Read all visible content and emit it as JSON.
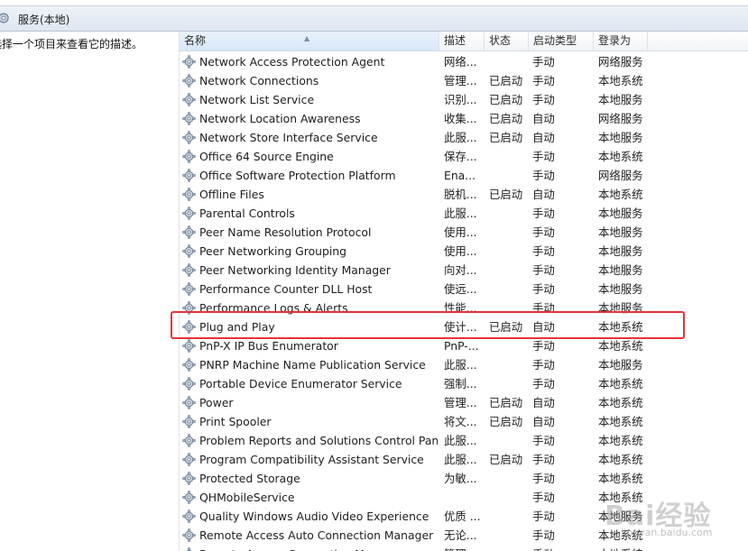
{
  "window": {
    "title": "服务(本地)"
  },
  "description_pane": {
    "text": "选择一个项目来查看它的描述。"
  },
  "columns": {
    "name": "名称",
    "desc": "描述",
    "status": "状态",
    "startup": "启动类型",
    "logon": "登录为"
  },
  "services": [
    {
      "name": "Network Access Protection Agent",
      "desc": "网络...",
      "status": "",
      "startup": "手动",
      "logon": "网络服务"
    },
    {
      "name": "Network Connections",
      "desc": "管理...",
      "status": "已启动",
      "startup": "手动",
      "logon": "本地系统"
    },
    {
      "name": "Network List Service",
      "desc": "识别...",
      "status": "已启动",
      "startup": "手动",
      "logon": "本地服务"
    },
    {
      "name": "Network Location Awareness",
      "desc": "收集...",
      "status": "已启动",
      "startup": "自动",
      "logon": "网络服务"
    },
    {
      "name": "Network Store Interface Service",
      "desc": "此服...",
      "status": "已启动",
      "startup": "自动",
      "logon": "本地服务"
    },
    {
      "name": "Office 64 Source Engine",
      "desc": "保存...",
      "status": "",
      "startup": "手动",
      "logon": "本地系统"
    },
    {
      "name": "Office Software Protection Platform",
      "desc": "Ena...",
      "status": "",
      "startup": "手动",
      "logon": "网络服务"
    },
    {
      "name": "Offline Files",
      "desc": "脱机...",
      "status": "已启动",
      "startup": "自动",
      "logon": "本地系统"
    },
    {
      "name": "Parental Controls",
      "desc": "此服...",
      "status": "",
      "startup": "手动",
      "logon": "本地服务"
    },
    {
      "name": "Peer Name Resolution Protocol",
      "desc": "使用...",
      "status": "",
      "startup": "手动",
      "logon": "本地服务"
    },
    {
      "name": "Peer Networking Grouping",
      "desc": "使用...",
      "status": "",
      "startup": "手动",
      "logon": "本地服务"
    },
    {
      "name": "Peer Networking Identity Manager",
      "desc": "向对...",
      "status": "",
      "startup": "手动",
      "logon": "本地服务"
    },
    {
      "name": "Performance Counter DLL Host",
      "desc": "使远...",
      "status": "",
      "startup": "手动",
      "logon": "本地服务"
    },
    {
      "name": "Performance Logs & Alerts",
      "desc": "性能...",
      "status": "",
      "startup": "手动",
      "logon": "本地服务"
    },
    {
      "name": "Plug and Play",
      "desc": "使计...",
      "status": "已启动",
      "startup": "自动",
      "logon": "本地系统"
    },
    {
      "name": "PnP-X IP Bus Enumerator",
      "desc": "PnP-...",
      "status": "",
      "startup": "手动",
      "logon": "本地系统"
    },
    {
      "name": "PNRP Machine Name Publication Service",
      "desc": "此服...",
      "status": "",
      "startup": "手动",
      "logon": "本地服务"
    },
    {
      "name": "Portable Device Enumerator Service",
      "desc": "强制...",
      "status": "",
      "startup": "手动",
      "logon": "本地系统"
    },
    {
      "name": "Power",
      "desc": "管理...",
      "status": "已启动",
      "startup": "自动",
      "logon": "本地系统"
    },
    {
      "name": "Print Spooler",
      "desc": "将文...",
      "status": "已启动",
      "startup": "自动",
      "logon": "本地系统"
    },
    {
      "name": "Problem Reports and Solutions Control Pan...",
      "desc": "此服...",
      "status": "",
      "startup": "手动",
      "logon": "本地系统"
    },
    {
      "name": "Program Compatibility Assistant Service",
      "desc": "此服...",
      "status": "已启动",
      "startup": "手动",
      "logon": "本地系统"
    },
    {
      "name": "Protected Storage",
      "desc": "为敏...",
      "status": "",
      "startup": "手动",
      "logon": "本地系统"
    },
    {
      "name": "QHMobileService",
      "desc": "",
      "status": "",
      "startup": "手动",
      "logon": "本地系统"
    },
    {
      "name": "Quality Windows Audio Video Experience",
      "desc": "优质 ...",
      "status": "",
      "startup": "手动",
      "logon": "本地服务"
    },
    {
      "name": "Remote Access Auto Connection Manager",
      "desc": "无论...",
      "status": "",
      "startup": "手动",
      "logon": "本地系统"
    },
    {
      "name": "Remote Access Connection Manager",
      "desc": "管理...",
      "status": "",
      "startup": "手动",
      "logon": "本地系统"
    }
  ],
  "watermark": {
    "brand": "Bai经验",
    "url": "jingyan.baidu.com"
  },
  "icons": {
    "window": "services-gear-icon",
    "row": "service-gear-icon"
  },
  "colors": {
    "highlight": "#e5343a",
    "sort_header": "#d7e7f8"
  }
}
